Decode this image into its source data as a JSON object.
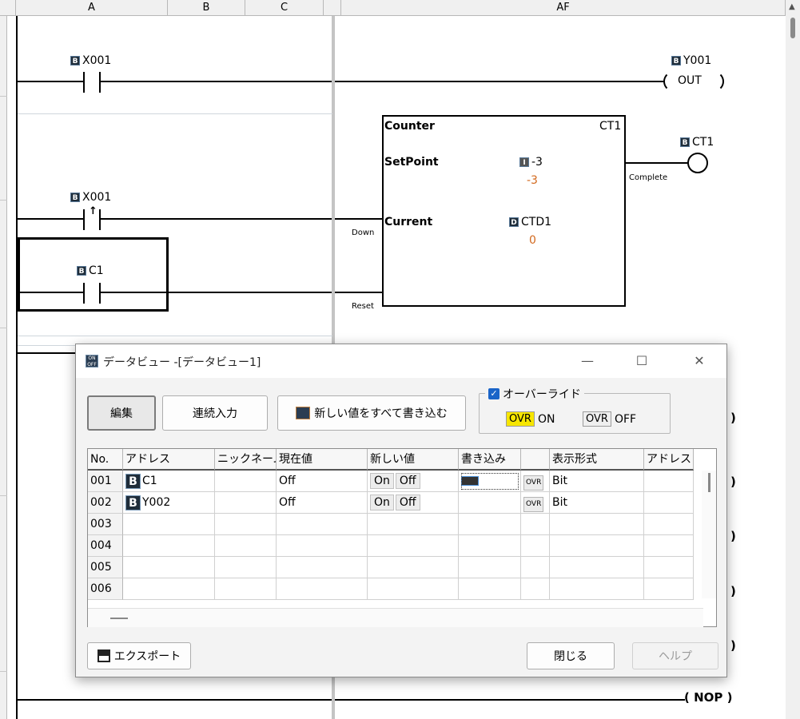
{
  "ladder": {
    "columns": [
      "A",
      "B",
      "C",
      "AF"
    ],
    "rung1": {
      "contact": "X001",
      "coil_address": "Y001",
      "coil_text": "OUT"
    },
    "rung2": {
      "contact": "X001",
      "reset_contact": "C1",
      "function_block": {
        "name": "Counter",
        "id": "CT1",
        "setpoint_label": "SetPoint",
        "setpoint_address": "-3",
        "setpoint_value": "-3",
        "current_label": "Current",
        "current_address": "CTD1",
        "current_value": "0",
        "pin_down": "Down",
        "pin_reset": "Reset",
        "pin_complete": "Complete"
      },
      "output_coil": "CT1"
    },
    "nop_text": "( NOP )",
    "paren": ")"
  },
  "dialog": {
    "title": "データビュー -[データビュー1]",
    "buttons": {
      "edit": "編集",
      "continuous_input": "連続入力",
      "write_all": "新しい値をすべて書き込む",
      "export": "エクスポート",
      "close": "閉じる",
      "help": "ヘルプ"
    },
    "override": {
      "label": "オーバーライド",
      "checked": true,
      "ovr_on_tag": "OVR",
      "on_text": "ON",
      "ovr_off_tag": "OVR",
      "off_text": "OFF"
    },
    "grid": {
      "headers": [
        "No.",
        "アドレス",
        "ニックネーム",
        "現在値",
        "新しい値",
        "書き込み",
        "",
        "表示形式",
        "アドレスコ"
      ],
      "rows": [
        {
          "no": "001",
          "address": "C1",
          "current": "Off",
          "new_on": "On",
          "new_off": "Off",
          "ovr": "OVR",
          "format": "Bit"
        },
        {
          "no": "002",
          "address": "Y002",
          "current": "Off",
          "new_on": "On",
          "new_off": "Off",
          "ovr": "OVR",
          "format": "Bit"
        },
        {
          "no": "003"
        },
        {
          "no": "004"
        },
        {
          "no": "005"
        },
        {
          "no": "006"
        }
      ]
    }
  }
}
